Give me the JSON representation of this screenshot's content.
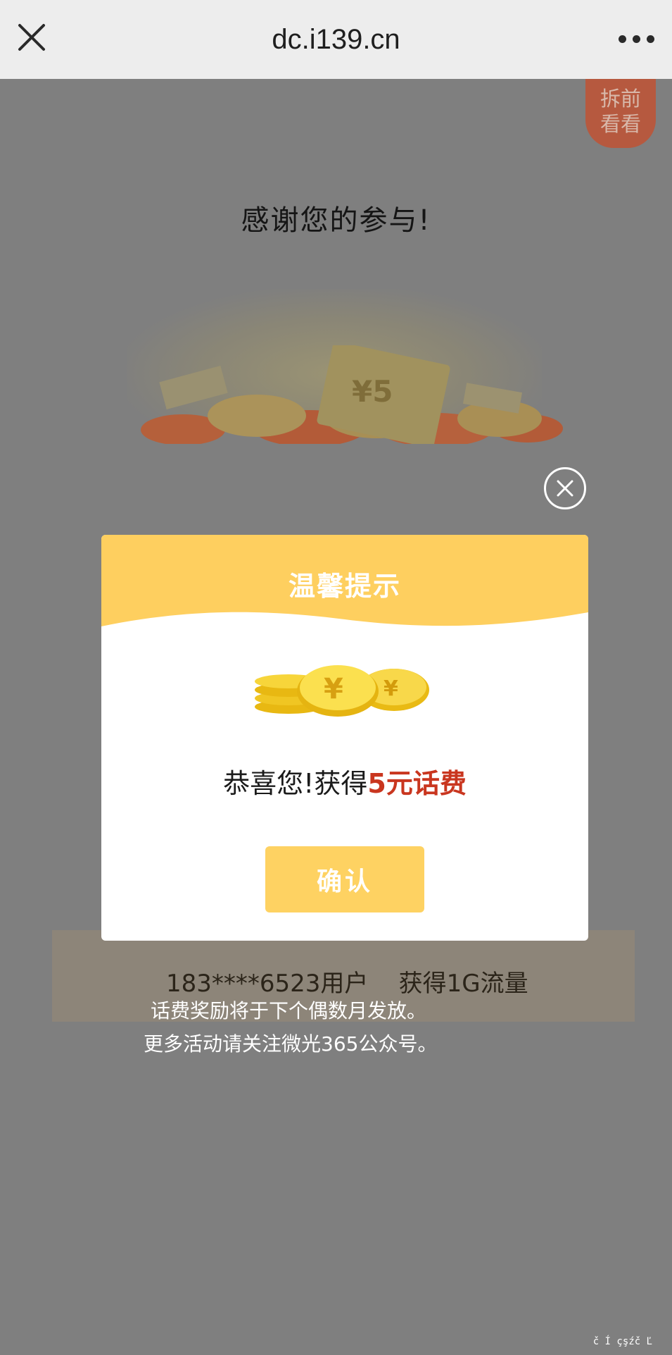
{
  "browser": {
    "url": "dc.i139.cn"
  },
  "page": {
    "side_badge_line1": "拆前",
    "side_badge_line2": "看看",
    "thanks": "感谢您的参与!",
    "banner_price": "¥5",
    "winner_text": "183****6523用户    获得1G流量",
    "note_line1": "话费奖励将于下个偶数月发放。",
    "note_line2": "更多活动请关注微光365公众号。"
  },
  "modal": {
    "title": "温馨提示",
    "congrats_prefix": "恭喜您!获得",
    "prize": "5元话费",
    "confirm_label": "确认"
  },
  "corner_glyphs": "č Í çşźč Ľ",
  "colors": {
    "modal_header": "#fecf5f",
    "confirm_button": "#fed262",
    "prize_text": "#c9361f"
  }
}
